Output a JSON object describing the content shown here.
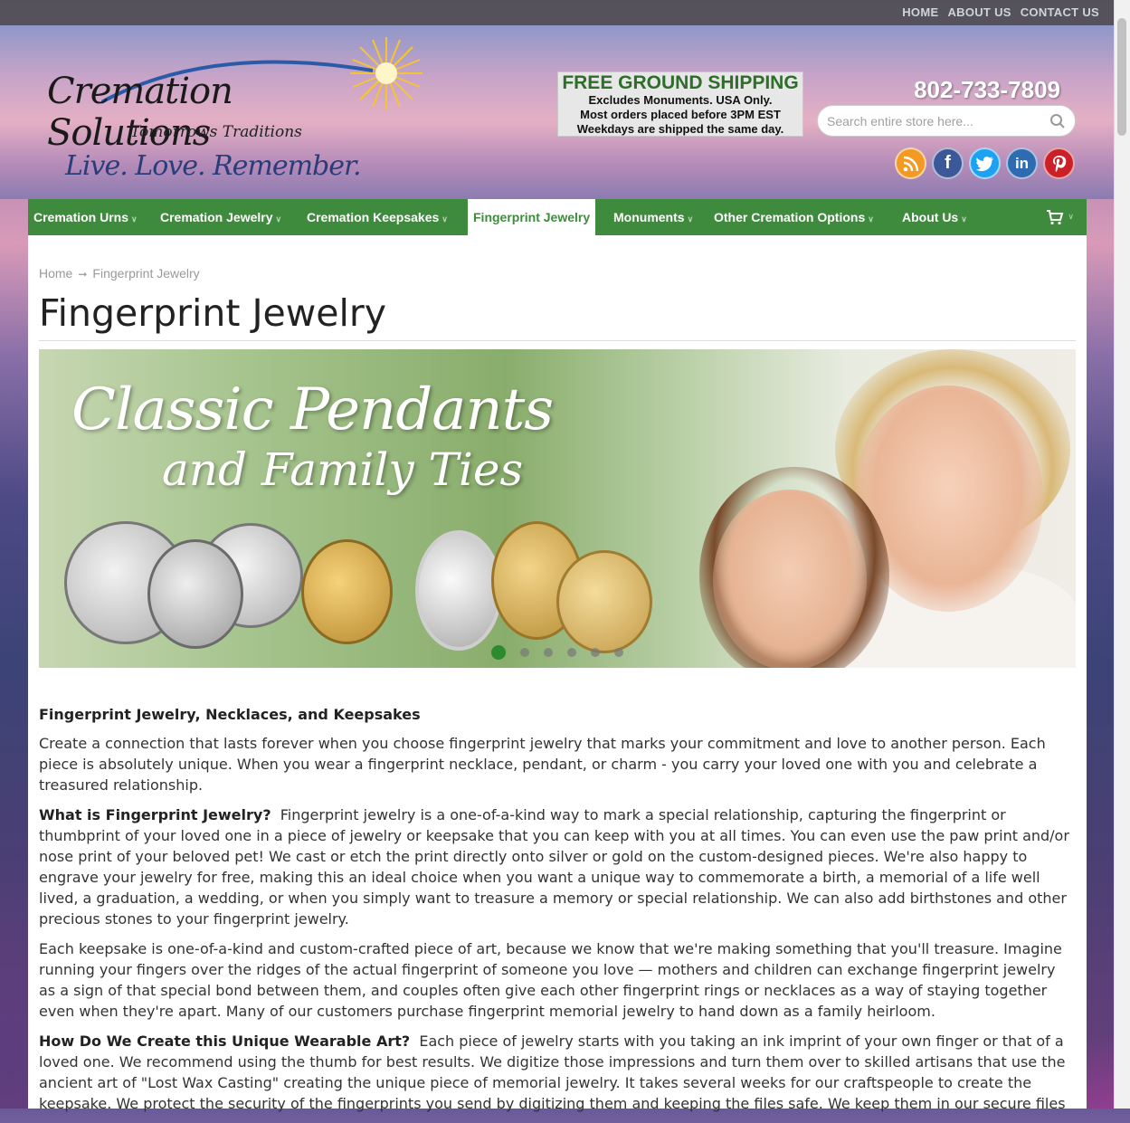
{
  "top_links": [
    "HOME",
    "ABOUT US",
    "CONTACT US"
  ],
  "logo": {
    "title": "Cremation Solutions",
    "subtitle": "Tomorrows Traditions",
    "tagline": "Live. Love. Remember."
  },
  "shipping": {
    "title": "FREE GROUND SHIPPING",
    "lines": [
      "Excludes Monuments. USA Only.",
      "Most orders placed before 3PM EST",
      "Weekdays are shipped the same day."
    ]
  },
  "phone": "802-733-7809",
  "search": {
    "placeholder": "Search entire store here..."
  },
  "socials": [
    {
      "name": "rss-icon",
      "glyph": "◉",
      "color": "#f39a24"
    },
    {
      "name": "facebook-icon",
      "glyph": "f",
      "color": "#3b5998"
    },
    {
      "name": "twitter-icon",
      "glyph": "t",
      "color": "#1da1f2"
    },
    {
      "name": "linkedin-icon",
      "glyph": "in",
      "color": "#2e6bb0"
    },
    {
      "name": "pinterest-icon",
      "glyph": "P",
      "color": "#cb2027"
    }
  ],
  "nav": {
    "items": [
      "Cremation Urns",
      "Cremation Jewelry",
      "Cremation Keepsakes",
      "Fingerprint Jewelry",
      "Monuments",
      "Other Cremation Options",
      "About Us"
    ],
    "active": "Fingerprint Jewelry"
  },
  "breadcrumb": {
    "home": "Home",
    "current": "Fingerprint Jewelry"
  },
  "page_title": "Fingerprint Jewelry",
  "banner": {
    "heading": "Classic Pendants",
    "subheading": "and Family Ties",
    "slides": 6,
    "active_slide": 1
  },
  "content": {
    "heading": "Fingerprint Jewelry, Necklaces, and Keepsakes",
    "p1": "Create a connection that lasts forever when you choose fingerprint jewelry that marks your commitment and love to another person. Each piece is absolutely unique. When you wear a fingerprint necklace, pendant, or charm - you carry your loved one with you and celebrate a treasured relationship.",
    "p2_lead": "What is Fingerprint Jewelry?",
    "p2": "Fingerprint jewelry is a one-of-a-kind way to mark a special relationship, capturing the fingerprint or thumbprint of your loved one in a piece of jewelry or keepsake that you can keep with you at all times. You can even use the paw print and/or nose print of your beloved pet! We cast or etch the print directly onto silver or gold on the custom-designed pieces. We're also happy to engrave your jewelry for free, making this an ideal choice when you want a unique way to commemorate a birth, a memorial of a life well lived, a graduation, a wedding, or when you simply want to treasure a memory or special relationship. We can also add birthstones and other precious stones to your fingerprint jewelry.",
    "p3": "Each keepsake is one-of-a-kind and custom-crafted piece of art, because we know that we're making something that you'll treasure. Imagine running your fingers over the ridges of the actual fingerprint of someone you love — mothers and children can exchange fingerprint jewelry as a sign of that special bond between them, and couples often give each other fingerprint rings or necklaces as a way of staying together even when they're apart. Many of our customers purchase fingerprint memorial jewelry to hand down as a family heirloom.",
    "p4_lead": "How Do We Create this Unique Wearable Art?",
    "p4": "Each piece of jewelry starts with you taking an ink imprint of your own finger or that of a loved one. We recommend using the thumb for best results. We digitize those impressions and turn them over to skilled artisans that use the ancient art of \"Lost Wax Casting\" creating the unique piece of memorial jewelry. It takes several weeks for our craftspeople to create the keepsake. We protect the security of the fingerprints you send by digitizing them and keeping the files safe. We keep them in our secure files"
  }
}
